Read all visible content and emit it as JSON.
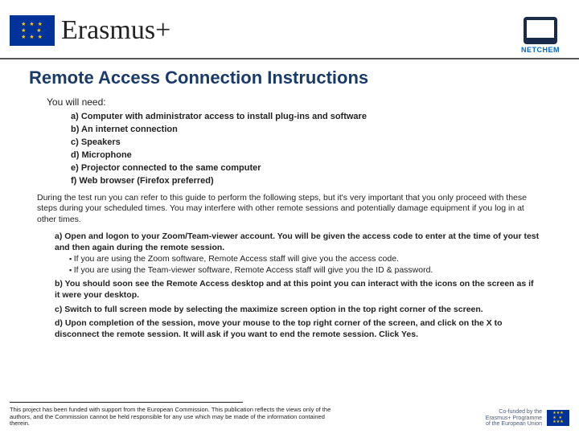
{
  "header": {
    "brand": "Erasmus+",
    "netchem_label": "NETCHEM"
  },
  "title": "Remote Access Connection Instructions",
  "need_intro": "You will need:",
  "needs": [
    {
      "mk": "a)",
      "text": "Computer with administrator access to install plug-ins and software"
    },
    {
      "mk": "b)",
      "text": "An internet connection"
    },
    {
      "mk": "c)",
      "text": "Speakers"
    },
    {
      "mk": "d)",
      "text": "Microphone"
    },
    {
      "mk": "e)",
      "text": "Projector connected to the same computer"
    },
    {
      "mk": "f)",
      "text": "Web browser (Firefox preferred)"
    }
  ],
  "paragraph": "During the test run you can refer to this guide to perform the following steps, but it's very important that you only proceed with these steps during your scheduled times. You may interfere with other remote sessions and potentially damage equipment if you log in at other times.",
  "steps": [
    {
      "mk": "a)",
      "text": "Open and logon to your Zoom/Team-viewer account. You will be given the access code to enter at the time of your test and then again during the remote session.",
      "sub": [
        "If you are using the Zoom software, Remote Access staff will give you the access code.",
        "If you are using the Team-viewer software, Remote Access staff will give you the ID & password."
      ]
    },
    {
      "mk": "b)",
      "text": "You should soon see the Remote Access desktop and at this point you can interact with the icons on the screen as if it were your desktop."
    },
    {
      "mk": "c)",
      "text": "Switch to full screen mode by selecting the maximize screen option in the top right corner of the screen."
    },
    {
      "mk": "d)",
      "text": "Upon completion of the session, move your mouse to the top right corner of the screen, and click on the X to disconnect the remote session. It will ask if you want to end the remote session. Click Yes."
    }
  ],
  "footer": {
    "disclaimer": "This project has been funded with support from the European Commission. This publication reflects the views only of the authors, and the Commission cannot be held responsible for any use which may be made of the information contained therein.",
    "cofund": "Co-funded by the\nErasmus+ Programme\nof the European Union"
  }
}
